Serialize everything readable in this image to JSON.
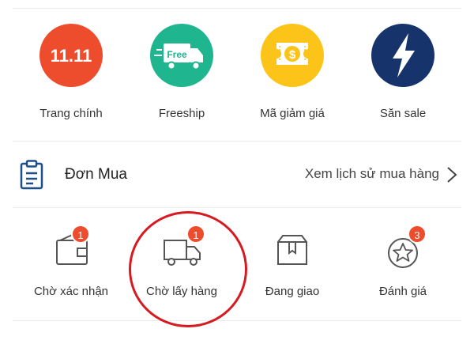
{
  "quick_links": [
    {
      "label": "Trang chính",
      "icon": "sale-11-11-icon",
      "icon_text": "11.11",
      "color": "#ee4d2d"
    },
    {
      "label": "Freeship",
      "icon": "free-truck-icon",
      "icon_text": "Free",
      "color": "#1fb58f"
    },
    {
      "label": "Mã giảm giá",
      "icon": "dollar-voucher-icon",
      "color": "#fcc419"
    },
    {
      "label": "Săn sale",
      "icon": "lightning-icon",
      "color": "#16346b"
    }
  ],
  "orders": {
    "title": "Đơn Mua",
    "history_link": "Xem lịch sử mua hàng",
    "icon": "clipboard-icon",
    "accent": "#1c4e8a"
  },
  "order_statuses": [
    {
      "label": "Chờ xác nhận",
      "icon": "wallet-icon",
      "badge": "1"
    },
    {
      "label": "Chờ lấy hàng",
      "icon": "truck-icon",
      "badge": "1"
    },
    {
      "label": "Đang giao",
      "icon": "package-icon",
      "badge": ""
    },
    {
      "label": "Đánh giá",
      "icon": "star-icon",
      "badge": "3"
    }
  ],
  "colors": {
    "badge": "#ee4d2d",
    "highlight": "#d71920"
  }
}
